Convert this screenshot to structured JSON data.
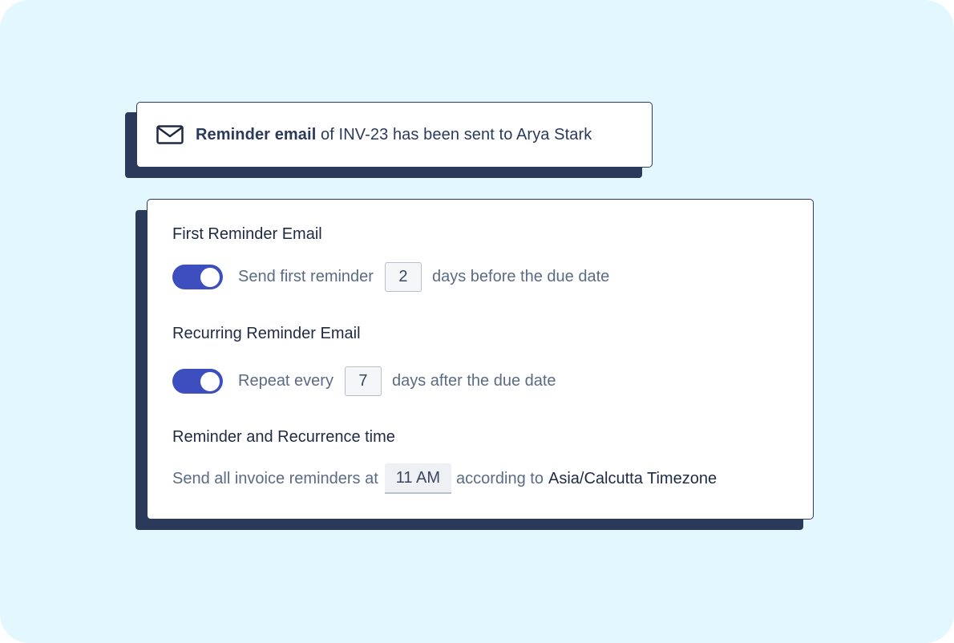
{
  "notification": {
    "icon": "mail-icon",
    "bold_text": "Reminder email",
    "rest_text": " of INV-23 has been sent to Arya Stark"
  },
  "settings": {
    "first": {
      "title": "First Reminder Email",
      "toggle_on": true,
      "label_before": "Send first reminder",
      "value": "2",
      "label_after": "days before the due date"
    },
    "recurring": {
      "title": "Recurring Reminder Email",
      "toggle_on": true,
      "label_before": "Repeat every",
      "value": "7",
      "label_after": "days after the due date"
    },
    "time": {
      "title": "Reminder and Recurrence time",
      "label_before": "Send all invoice reminders at",
      "value": "11 AM",
      "label_middle": "according to",
      "timezone": "Asia/Calcutta Timezone"
    }
  },
  "colors": {
    "background": "#e3f8fe",
    "card_shadow": "#2b3a5a",
    "toggle_on": "#3d4fbf"
  }
}
